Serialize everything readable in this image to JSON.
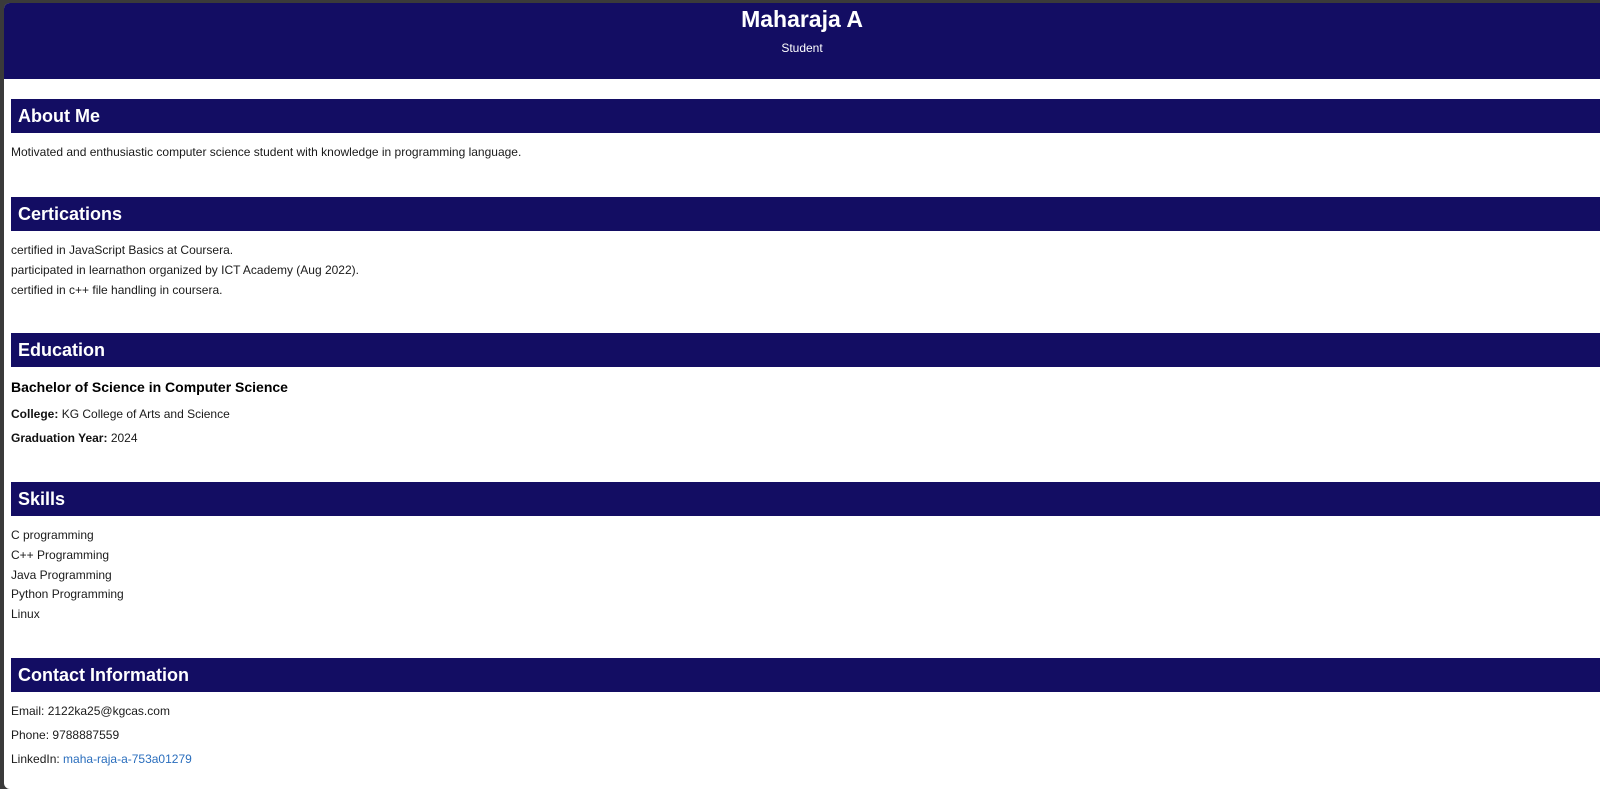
{
  "header": {
    "name": "Maharaja A",
    "role": "Student"
  },
  "about": {
    "heading": "About Me",
    "text": "Motivated and enthusiastic computer science student with knowledge in programming language."
  },
  "certifications": {
    "heading": "Certications",
    "items": [
      "certified in JavaScript Basics at Coursera.",
      "participated in learnathon organized by ICT Academy (Aug 2022).",
      "certified in c++ file handling in coursera."
    ]
  },
  "education": {
    "heading": "Education",
    "degree": "Bachelor of Science in Computer Science",
    "college_label": "College:",
    "college_value": "KG College of Arts and Science",
    "year_label": "Graduation Year:",
    "year_value": "2024"
  },
  "skills": {
    "heading": "Skills",
    "items": [
      "C programming",
      "C++ Programming",
      "Java Programming",
      "Python Programming",
      "Linux"
    ]
  },
  "contact": {
    "heading": "Contact Information",
    "email_label": "Email:",
    "email_value": "2122ka25@kgcas.com",
    "phone_label": "Phone:",
    "phone_value": "9788887559",
    "linkedin_label": "LinkedIn:",
    "linkedin_value": "maha-raja-a-753a01279"
  },
  "colors": {
    "header_bg": "#130d63",
    "link": "#2a6ebd"
  }
}
